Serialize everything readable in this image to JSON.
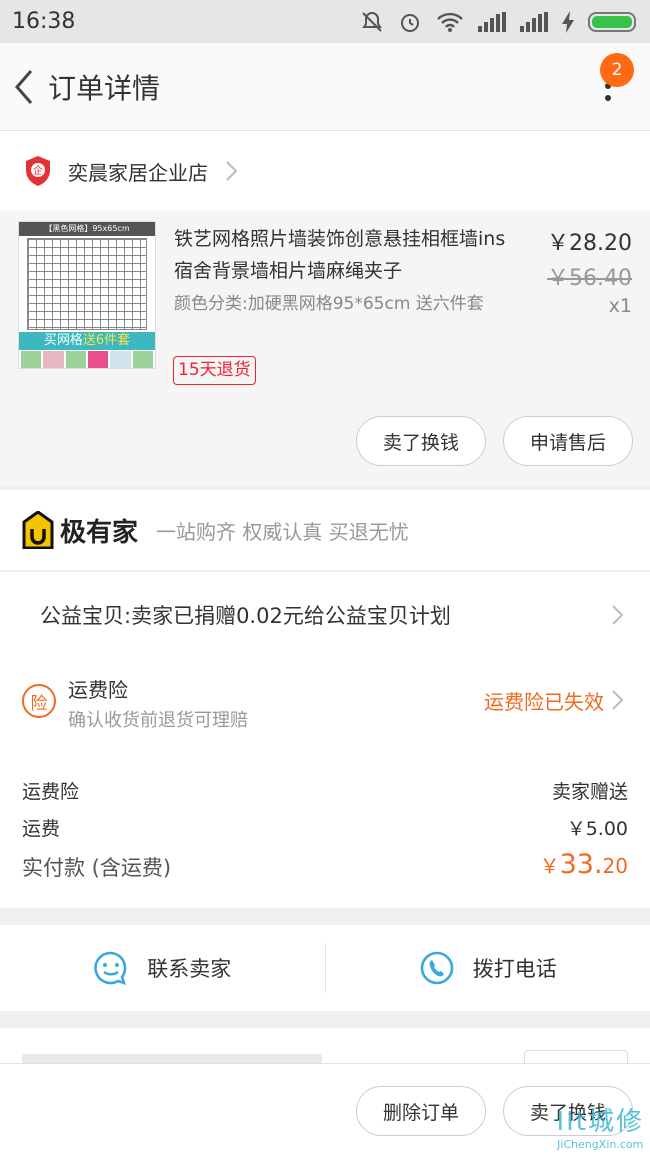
{
  "status_bar": {
    "time": "16:38"
  },
  "header": {
    "title": "订单详情",
    "badge_count": "2"
  },
  "shop": {
    "name": "奕晨家居企业店"
  },
  "item": {
    "title": "铁艺网格照片墙装饰创意悬挂相框墙ins宿舍背景墙相片墙麻绳夹子",
    "spec": "颜色分类:加硬黑网格95*65cm  送六件套",
    "refund_tag": "15天退货",
    "price": "￥28.20",
    "original_price": "￥56.40",
    "quantity": "x1",
    "thumb": {
      "header": "【黑色网格】95x65cm",
      "promo_a": "买网格",
      "promo_b": "送6件套"
    },
    "sell_button": "卖了换钱",
    "after_sale_button": "申请售后"
  },
  "brand": {
    "name": "极有家",
    "slogan": "一站购齐 权威认真 买退无忧"
  },
  "charity": {
    "text": "公益宝贝:卖家已捐赠0.02元给公益宝贝计划"
  },
  "insurance": {
    "icon_char": "险",
    "title": "运费险",
    "subtitle": "确认收货前退货可理赔",
    "status": "运费险已失效"
  },
  "fees": [
    {
      "label": "运费险",
      "value": "卖家赠送"
    },
    {
      "label": "运费",
      "value": "￥5.00"
    }
  ],
  "total": {
    "label": "实付款 (含运费)",
    "currency": "￥",
    "integer": "33.",
    "decimal": "20"
  },
  "contact": {
    "seller_label": "联系卖家",
    "phone_label": "拨打电话"
  },
  "actions": {
    "delete_label": "删除订单",
    "sell_label": "卖了换钱"
  },
  "watermark": {
    "main": "IIt城修",
    "sub": "JiChengXin.com"
  },
  "colors": {
    "accent": "#f36a1f",
    "badge": "#ff6a12",
    "refund": "#e23333",
    "contact_icon": "#39a8de",
    "shop_shield": "#e23333"
  }
}
